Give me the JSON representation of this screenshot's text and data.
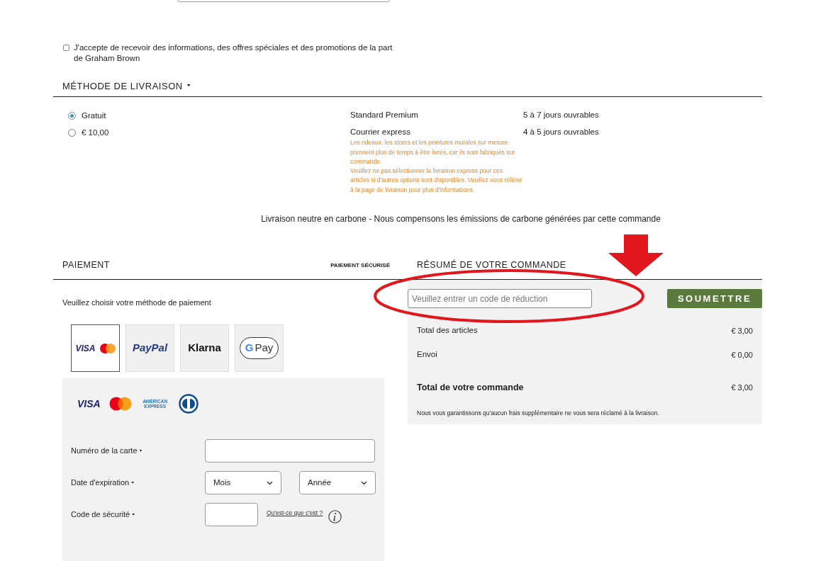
{
  "newsletter": {
    "label": "J'accepte de recevoir des informations, des offres spéciales et des promotions de la part de Graham Brown",
    "checked": false
  },
  "delivery": {
    "heading": "MÉTHODE DE LIVRAISON",
    "options": [
      {
        "price": "Gratuit",
        "service": "Standard Premium",
        "time": "5 à 7 jours ouvrables",
        "selected": true
      },
      {
        "price": "€ 10,00",
        "service": "Courrier express",
        "time": "4 à 5 jours ouvrables",
        "selected": false,
        "notes": [
          "Les rideaux, les stores et les peintures murales sur mesure prennent plus de temps à être livrés, car ils sont fabriqués sur commande.",
          "Veuillez ne pas sélectionner la livraison express pour ces articles si d'autres options sont disponibles. Veuillez vous référer à la page de livraison pour plus d'informations."
        ]
      }
    ],
    "carbon_note": "Livraison neutre en carbone - Nous compensons les émissions de carbone générées par cette commande"
  },
  "payment": {
    "heading": "PAIEMENT",
    "secure": "PAIEMENT SÉCURISÉ",
    "prompt": "Veuillez choisir votre méthode de paiement",
    "methods": [
      {
        "kind": "card",
        "label": "VISA",
        "selected": true
      },
      {
        "kind": "paypal",
        "label": "PayPal",
        "selected": false
      },
      {
        "kind": "klarna",
        "label": "Klarna",
        "selected": false
      },
      {
        "kind": "gpay",
        "label": "Pay",
        "mark": "G",
        "selected": false
      }
    ],
    "card_logos": [
      {
        "kind": "visa",
        "label": "VISA"
      },
      {
        "kind": "mastercard"
      },
      {
        "kind": "amex",
        "label": "AMERICAN EXPRESS"
      },
      {
        "kind": "diners"
      }
    ],
    "fields": [
      {
        "kind": "text",
        "label": "Numéro de la carte"
      },
      {
        "kind": "selects",
        "label": "Date d'expiration",
        "options": [
          "Mois",
          "Année"
        ]
      },
      {
        "kind": "cvc",
        "label": "Code de sécurité",
        "link": "Qu'est-ce que c'est ?"
      }
    ]
  },
  "summary": {
    "heading": "RÉSUMÉ DE VOTRE COMMANDE",
    "discount_placeholder": "Veuillez entrer un code de réduction",
    "submit": "SOUMETTRE",
    "lines": [
      {
        "label": "Total des articles",
        "value": "€ 3,00",
        "bold": false
      },
      {
        "label": "Envoi",
        "value": "€ 0,00",
        "bold": false
      },
      {
        "label": "Total de votre commande",
        "value": "€ 3,00",
        "bold": true
      }
    ],
    "guarantee": "Nous vous garantissons qu'aucun frais supplémentaire ne vous sera réclamé à la livraison."
  }
}
